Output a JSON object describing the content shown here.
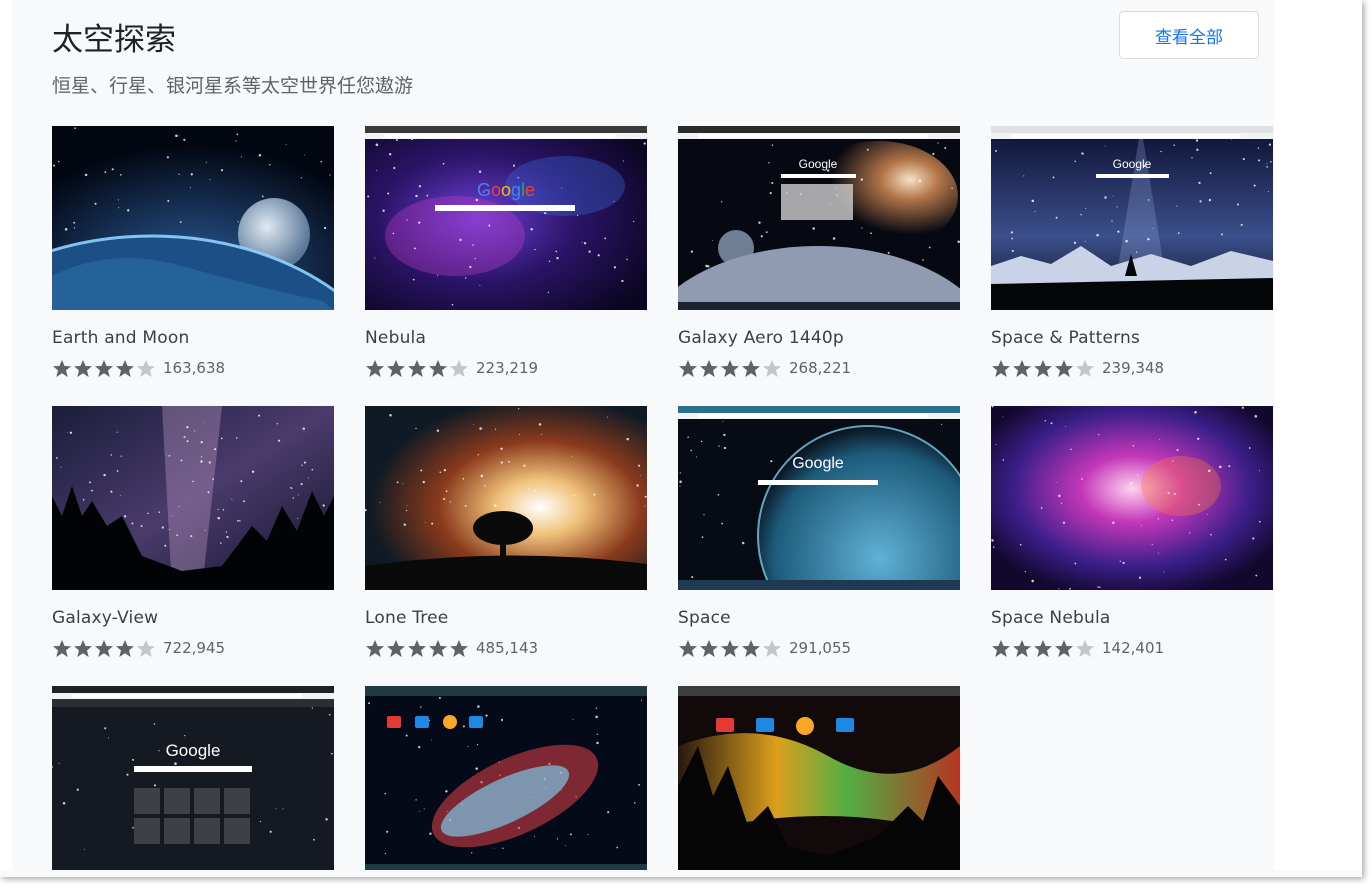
{
  "section": {
    "title": "太空探索",
    "subtitle": "恒星、行星、银河星系等太空世界任您遨游",
    "view_all_label": "查看全部"
  },
  "colors": {
    "star_filled": "#5f6368",
    "star_empty": "#c4c7ca",
    "link": "#1a73e8"
  },
  "themes": [
    {
      "name": "Earth and Moon",
      "rating": 4,
      "count": "163,638",
      "thumb": "earth-moon",
      "thumb_text": ""
    },
    {
      "name": "Nebula",
      "rating": 4,
      "count": "223,219",
      "thumb": "nebula",
      "thumb_text": "Google"
    },
    {
      "name": "Galaxy Aero 1440p",
      "rating": 4,
      "count": "268,221",
      "thumb": "galaxy-aero",
      "thumb_text": "Google"
    },
    {
      "name": "Space & Patterns",
      "rating": 4,
      "count": "239,348",
      "thumb": "space-patterns",
      "thumb_text": "Google"
    },
    {
      "name": "Galaxy-View",
      "rating": 4,
      "count": "722,945",
      "thumb": "galaxy-view",
      "thumb_text": ""
    },
    {
      "name": "Lone Tree",
      "rating": 5,
      "count": "485,143",
      "thumb": "lone-tree",
      "thumb_text": ""
    },
    {
      "name": "Space",
      "rating": 4,
      "count": "291,055",
      "thumb": "space",
      "thumb_text": "Google"
    },
    {
      "name": "Space Nebula",
      "rating": 4,
      "count": "142,401",
      "thumb": "space-nebula",
      "thumb_text": ""
    },
    {
      "name": "",
      "rating": 0,
      "count": "",
      "thumb": "dark-google",
      "thumb_text": "Google"
    },
    {
      "name": "",
      "rating": 0,
      "count": "",
      "thumb": "cosmic-cloud",
      "thumb_text": ""
    },
    {
      "name": "",
      "rating": 0,
      "count": "",
      "thumb": "aurora-forest",
      "thumb_text": ""
    }
  ]
}
